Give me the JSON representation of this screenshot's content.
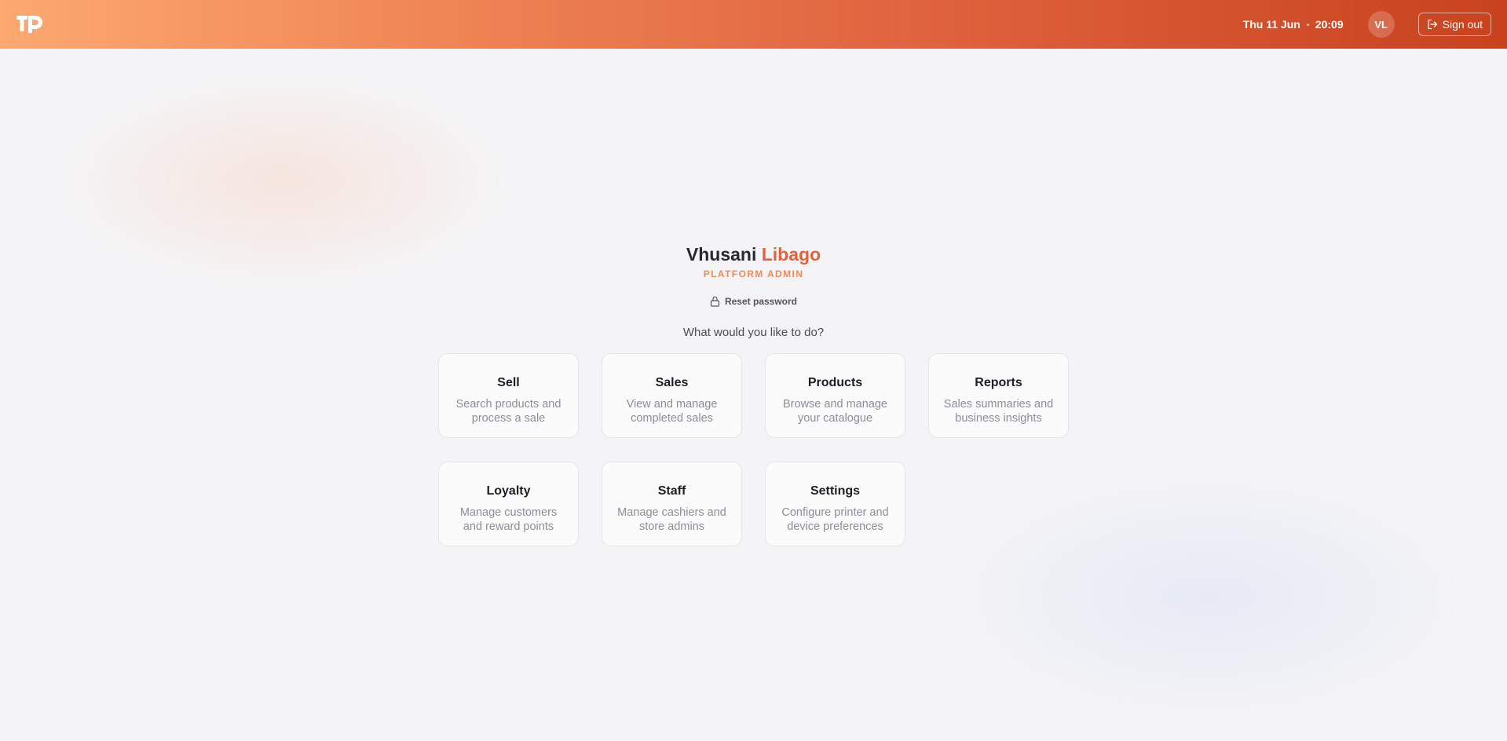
{
  "header": {
    "date": "Thu 11 Jun",
    "time": "20:09",
    "avatar_initials": "VL",
    "signout_label": "Sign out"
  },
  "user": {
    "first_name": "Vhusani",
    "last_name": "Libago",
    "role": "PLATFORM ADMIN"
  },
  "reset_label": "Reset password",
  "prompt": "What would you like to do?",
  "cards": [
    {
      "title": "Sell",
      "desc": "Search products and process a sale"
    },
    {
      "title": "Sales",
      "desc": "View and manage completed sales"
    },
    {
      "title": "Products",
      "desc": "Browse and manage your catalogue"
    },
    {
      "title": "Reports",
      "desc": "Sales summaries and business insights"
    },
    {
      "title": "Loyalty",
      "desc": "Manage customers and reward points"
    },
    {
      "title": "Staff",
      "desc": "Manage cashiers and store admins"
    },
    {
      "title": "Settings",
      "desc": "Configure printer and device preferences"
    }
  ],
  "colors": {
    "accent": "#e0643f",
    "header_start": "#fda871",
    "header_end": "#c8421e",
    "background": "#f4f4f6"
  },
  "icons": {
    "logo": "tp-logo-icon",
    "signout": "sign-out-icon",
    "reset": "lock-icon"
  }
}
